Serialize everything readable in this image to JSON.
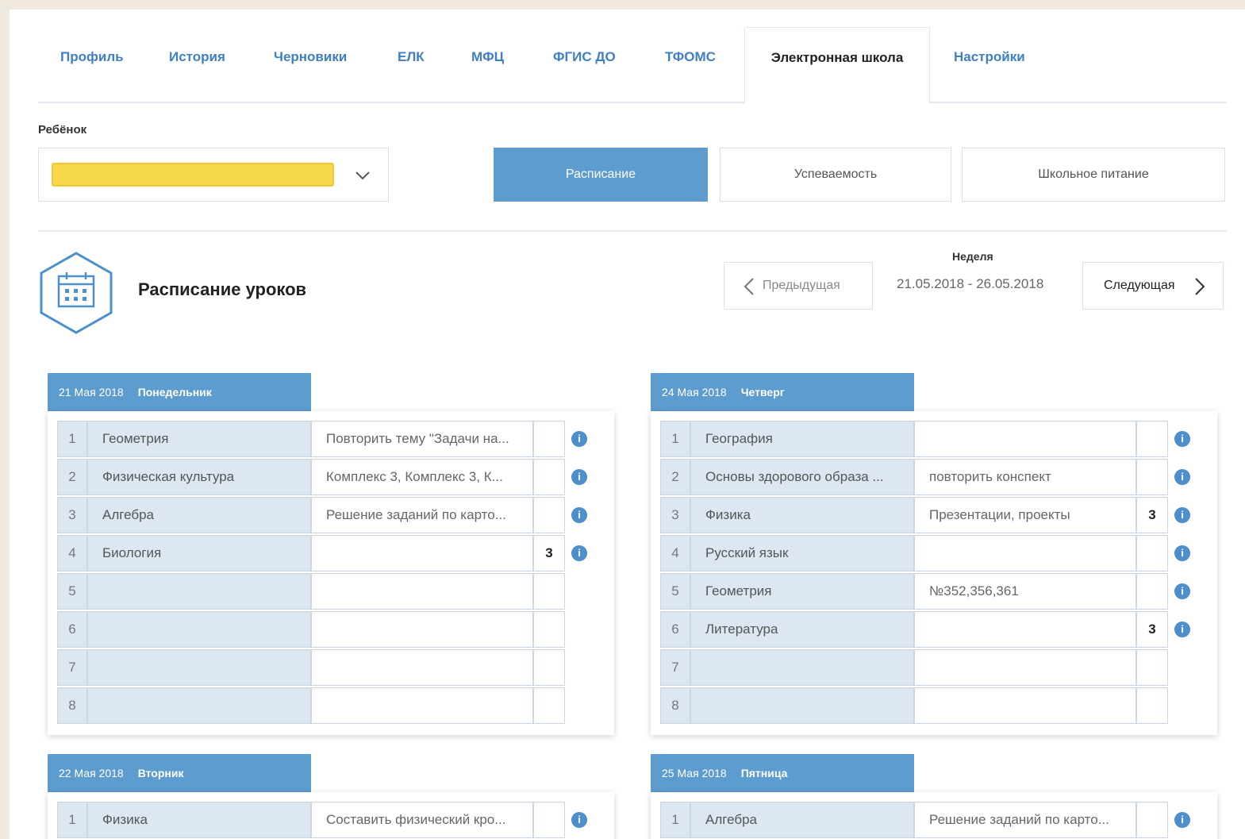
{
  "tabs": [
    {
      "label": "Профиль"
    },
    {
      "label": "История"
    },
    {
      "label": "Черновики"
    },
    {
      "label": "ЕЛК"
    },
    {
      "label": "МФЦ"
    },
    {
      "label": "ФГИС ДО"
    },
    {
      "label": "ТФОМС"
    },
    {
      "label": "Электронная школа",
      "active": true
    },
    {
      "label": "Настройки"
    }
  ],
  "child": {
    "label": "Ребёнок",
    "value": ""
  },
  "modes": [
    {
      "label": "Расписание",
      "active": true
    },
    {
      "label": "Успеваемость"
    },
    {
      "label": "Школьное питание"
    }
  ],
  "schedule": {
    "title": "Расписание уроков",
    "prev_label": "Предыдущая",
    "next_label": "Следующая",
    "week_label": "Неделя",
    "week_range": "21.05.2018 - 26.05.2018"
  },
  "days": [
    {
      "date": "21 Мая 2018",
      "weekday": "Понедельник",
      "lessons": [
        {
          "num": "1",
          "subject": "Геометрия",
          "homework": "Повторить тему \"Задачи на...",
          "mark": "",
          "info": true
        },
        {
          "num": "2",
          "subject": "Физическая культура",
          "homework": "Комплекс 3, Комплекс 3, К...",
          "mark": "",
          "info": true
        },
        {
          "num": "3",
          "subject": "Алгебра",
          "homework": "Решение заданий по карто...",
          "mark": "",
          "info": true
        },
        {
          "num": "4",
          "subject": "Биология",
          "homework": "",
          "mark": "3",
          "info": true
        },
        {
          "num": "5",
          "subject": "",
          "homework": "",
          "mark": "",
          "info": false
        },
        {
          "num": "6",
          "subject": "",
          "homework": "",
          "mark": "",
          "info": false
        },
        {
          "num": "7",
          "subject": "",
          "homework": "",
          "mark": "",
          "info": false
        },
        {
          "num": "8",
          "subject": "",
          "homework": "",
          "mark": "",
          "info": false
        }
      ]
    },
    {
      "date": "24 Мая 2018",
      "weekday": "Четверг",
      "lessons": [
        {
          "num": "1",
          "subject": "География",
          "homework": "",
          "mark": "",
          "info": true
        },
        {
          "num": "2",
          "subject": "Основы здорового образа ...",
          "homework": "повторить конспект",
          "mark": "",
          "info": true
        },
        {
          "num": "3",
          "subject": "Физика",
          "homework": "Презентации, проекты",
          "mark": "3",
          "info": true
        },
        {
          "num": "4",
          "subject": "Русский язык",
          "homework": "",
          "mark": "",
          "info": true
        },
        {
          "num": "5",
          "subject": "Геометрия",
          "homework": "№352,356,361",
          "mark": "",
          "info": true
        },
        {
          "num": "6",
          "subject": "Литература",
          "homework": "",
          "mark": "3",
          "info": true
        },
        {
          "num": "7",
          "subject": "",
          "homework": "",
          "mark": "",
          "info": false
        },
        {
          "num": "8",
          "subject": "",
          "homework": "",
          "mark": "",
          "info": false
        }
      ]
    },
    {
      "date": "22 Мая 2018",
      "weekday": "Вторник",
      "lessons": [
        {
          "num": "1",
          "subject": "Физика",
          "homework": "Составить физический кро...",
          "mark": "",
          "info": true
        }
      ]
    },
    {
      "date": "25 Мая 2018",
      "weekday": "Пятница",
      "lessons": [
        {
          "num": "1",
          "subject": "Алгебра",
          "homework": "Решение заданий по карто...",
          "mark": "",
          "info": true
        }
      ]
    }
  ],
  "icons": {
    "info": "info-icon",
    "calendar": "calendar-icon",
    "chevron": "chevron-down-icon"
  },
  "colors": {
    "accent": "#5d9ccf",
    "link": "#3f7fc4"
  }
}
